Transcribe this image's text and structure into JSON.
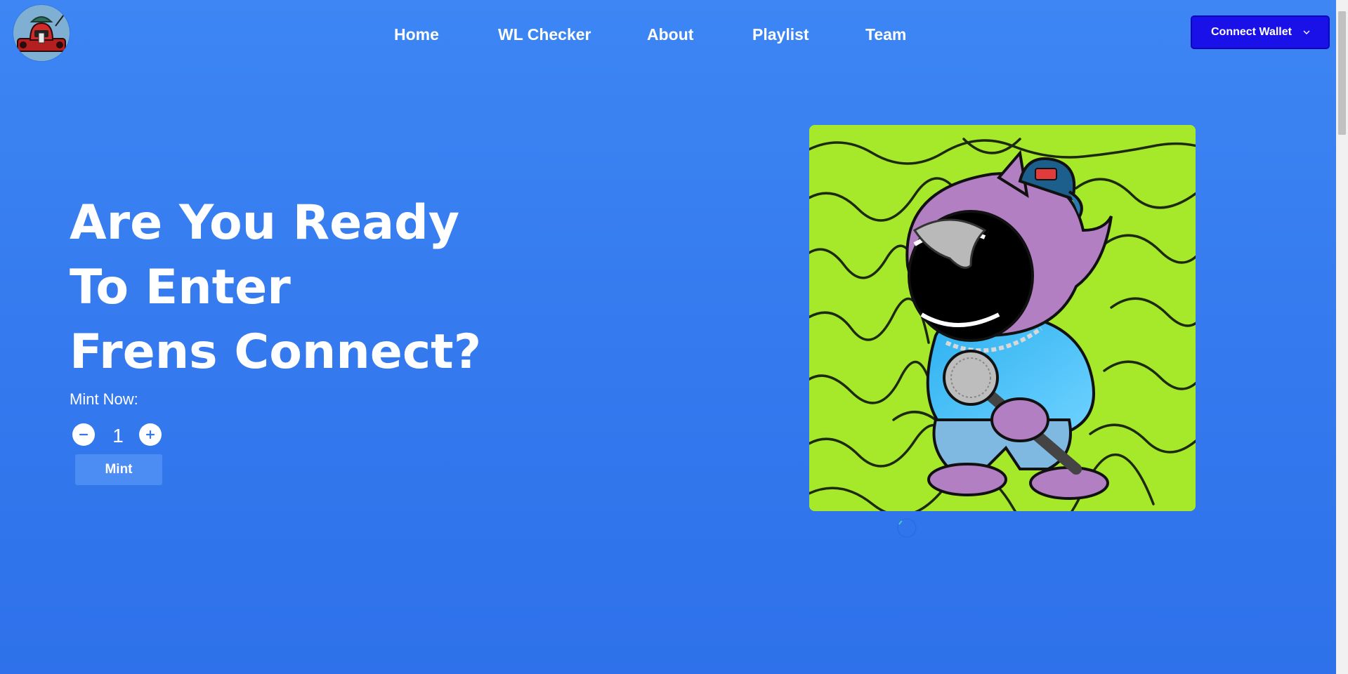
{
  "logo": {
    "icon": "brand-logo-icon"
  },
  "nav": {
    "items": [
      {
        "label": "Home"
      },
      {
        "label": "WL Checker"
      },
      {
        "label": "About"
      },
      {
        "label": "Playlist"
      },
      {
        "label": "Team"
      }
    ]
  },
  "wallet": {
    "label": "Connect Wallet",
    "icon": "chevron-down-icon"
  },
  "hero": {
    "title_lines": [
      "Are You Ready",
      "To Enter",
      "Frens Connect?"
    ]
  },
  "mint": {
    "label": "Mint Now:",
    "quantity": "1",
    "decrement_icon": "minus-icon",
    "increment_icon": "plus-icon",
    "button_label": "Mint"
  },
  "artwork": {
    "icon": "nft-character-artwork"
  },
  "colors": {
    "background": "#3479ee",
    "wallet_button": "#1a10e8",
    "mint_button": "#4b8df2",
    "artwork_background": "#a4e82c"
  }
}
